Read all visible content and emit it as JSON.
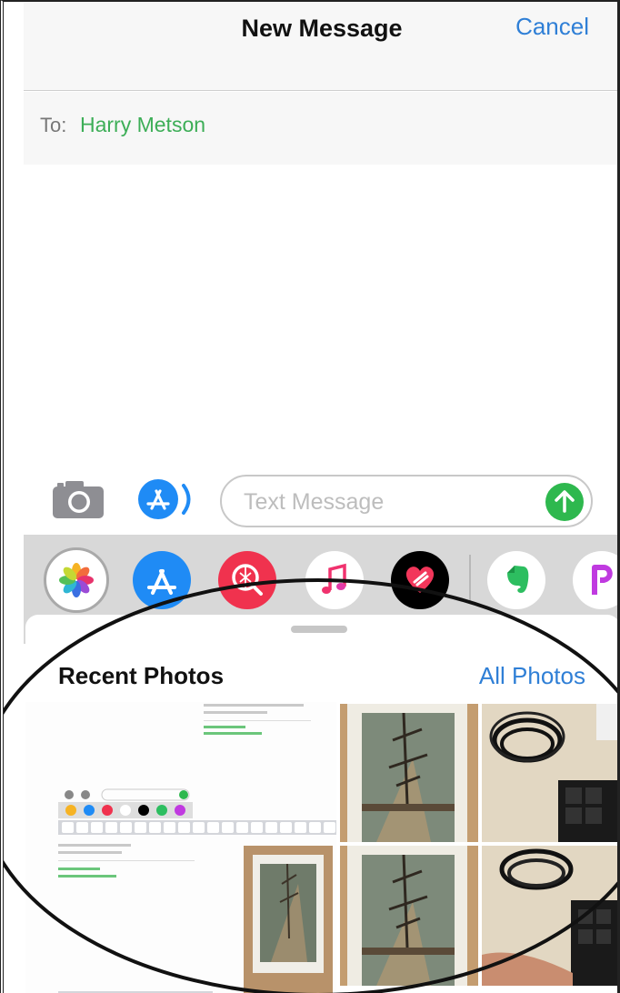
{
  "nav": {
    "title": "New Message",
    "cancel_label": "Cancel"
  },
  "to": {
    "label": "To:",
    "recipient": "Harry Metson"
  },
  "compose": {
    "placeholder": "Text Message"
  },
  "drawer": {
    "apps": [
      "photos-icon",
      "app-store-icon",
      "images-search-icon",
      "music-icon",
      "digital-touch-icon",
      "evernote-icon",
      "picsart-icon"
    ]
  },
  "sheet": {
    "title": "Recent Photos",
    "all_photos_label": "All Photos",
    "mini_keyboard_row": [
      "q",
      "w",
      "e",
      "r",
      "t",
      "y",
      "u",
      "i",
      "o",
      "p"
    ]
  },
  "colors": {
    "accent": "#2f7fd6",
    "recipient": "#3dae57",
    "send": "#2eb84e"
  }
}
